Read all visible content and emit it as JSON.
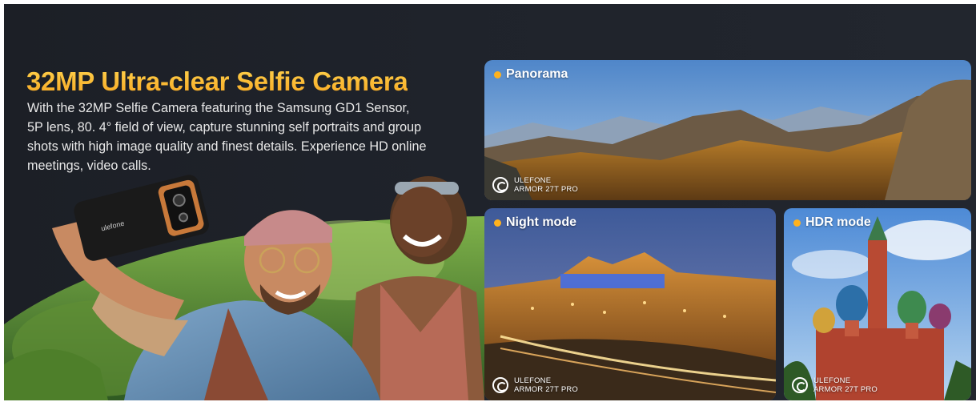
{
  "hero": {
    "headline": "32MP Ultra-clear Selfie Camera",
    "description": "With the 32MP Selfie Camera featuring the Samsung GD1 Sensor, 5P lens, 80. 4° field of view, capture stunning self portraits and group shots with high image quality and finest details. Experience HD online meetings, video calls.",
    "phone_brand": "ulefone"
  },
  "cards": {
    "panorama": {
      "label": "Panorama",
      "watermark_line1": "ULEFONE",
      "watermark_line2": "ARMOR 27T PRO"
    },
    "night": {
      "label": "Night mode",
      "watermark_line1": "ULEFONE",
      "watermark_line2": "ARMOR 27T PRO"
    },
    "hdr": {
      "label": "HDR mode",
      "watermark_line1": "ULEFONE",
      "watermark_line2": "ARMOR 27T PRO"
    }
  },
  "colors": {
    "background": "#1f232b",
    "headline_gradient_top": "#ffd24d",
    "headline_gradient_bottom": "#f7a722",
    "label_dot": "#ffb21e",
    "body_text": "#e8e8e8"
  },
  "icons": {
    "watermark": "camera-shutter-icon",
    "label_marker": "bullet-dot-icon"
  }
}
